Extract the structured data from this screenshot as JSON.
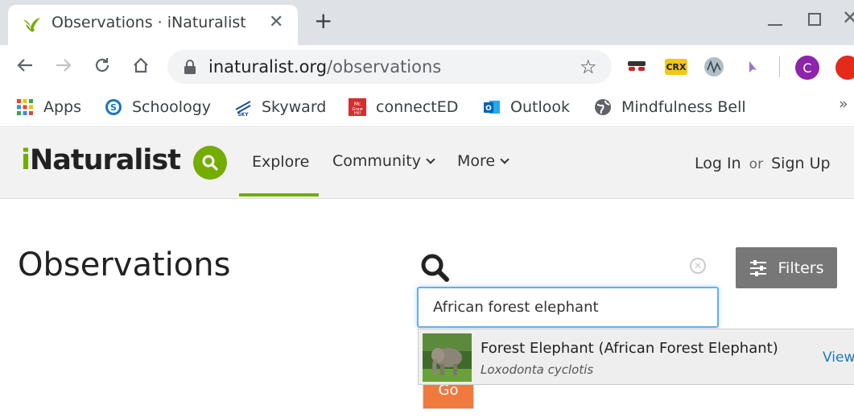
{
  "browser": {
    "tab_title": "Observations · iNaturalist",
    "tab_close": "✕",
    "new_tab": "+",
    "window_close": "✕",
    "url_host": "inaturalist.org",
    "url_path": "/observations",
    "extension_crx_label": "CRX",
    "profile_initial": "C",
    "bookmarks": [
      {
        "label": "Apps",
        "icon": "apps-grid-icon"
      },
      {
        "label": "Schoology",
        "icon": "schoology-icon"
      },
      {
        "label": "Skyward",
        "icon": "skyward-icon"
      },
      {
        "label": "connectED",
        "icon": "mcgraw-hill-icon"
      },
      {
        "label": "Outlook",
        "icon": "outlook-icon"
      },
      {
        "label": "Mindfulness Bell",
        "icon": "globe-icon"
      }
    ],
    "bookmarks_overflow": "»"
  },
  "site": {
    "logo_i": "i",
    "logo_rest": "Naturalist",
    "nav": {
      "explore": "Explore",
      "community": "Community",
      "more": "More"
    },
    "auth": {
      "login": "Log In",
      "or": "or",
      "signup": "Sign Up"
    },
    "accent_color": "#74ac00"
  },
  "page": {
    "title": "Observations",
    "filters_label": "Filters",
    "clear_symbol": "✕",
    "search_value": "African forest elephant",
    "go_label": "Go",
    "suggestion": {
      "common_name": "Forest Elephant (African Forest Elephant)",
      "scientific_name": "Loxodonta cyclotis",
      "view_label": "View"
    }
  }
}
